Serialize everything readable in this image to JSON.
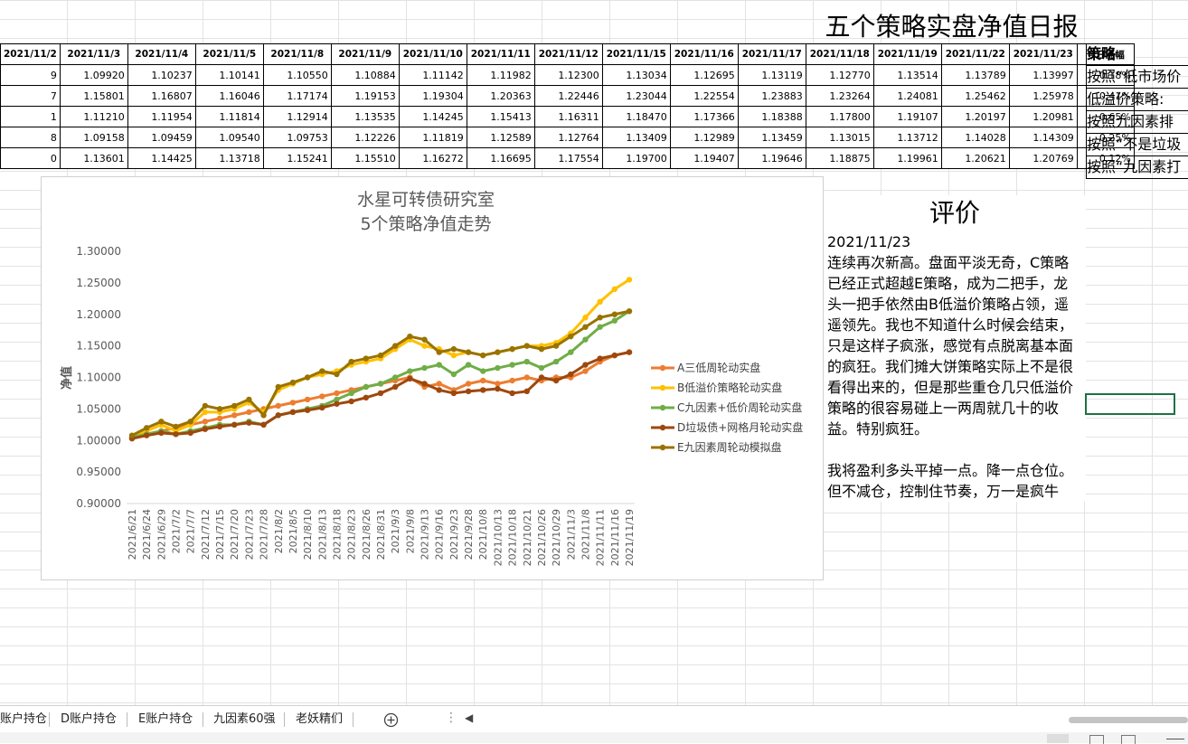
{
  "title": "五个策略实盘净值日报",
  "dates": [
    "2021/11/2",
    "2021/11/3",
    "2021/11/4",
    "2021/11/5",
    "2021/11/8",
    "2021/11/9",
    "2021/11/10",
    "2021/11/11",
    "2021/11/12",
    "2021/11/15",
    "2021/11/16",
    "2021/11/17",
    "2021/11/18",
    "2021/11/19",
    "2021/11/22",
    "2021/11/23"
  ],
  "change_header": "今日涨幅",
  "rows": [
    {
      "first": "9",
      "values": [
        "1.09920",
        "1.10237",
        "1.10141",
        "1.10550",
        "1.10884",
        "1.11142",
        "1.11982",
        "1.12300",
        "1.13034",
        "1.12695",
        "1.13119",
        "1.12770",
        "1.13514",
        "1.13789",
        "1.13997"
      ],
      "change": "0.18%"
    },
    {
      "first": "7",
      "values": [
        "1.15801",
        "1.16807",
        "1.16046",
        "1.17174",
        "1.19153",
        "1.19304",
        "1.20363",
        "1.22446",
        "1.23044",
        "1.22554",
        "1.23883",
        "1.23264",
        "1.24081",
        "1.25462",
        "1.25978"
      ],
      "change": "0.41%"
    },
    {
      "first": "1",
      "values": [
        "1.11210",
        "1.11954",
        "1.11814",
        "1.12914",
        "1.13535",
        "1.14245",
        "1.15413",
        "1.16311",
        "1.18470",
        "1.17366",
        "1.18388",
        "1.17800",
        "1.19107",
        "1.20197",
        "1.20981"
      ],
      "change": "0.65%"
    },
    {
      "first": "8",
      "values": [
        "1.09158",
        "1.09459",
        "1.09540",
        "1.09753",
        "1.12226",
        "1.11819",
        "1.12589",
        "1.12764",
        "1.13409",
        "1.12989",
        "1.13459",
        "1.13015",
        "1.13712",
        "1.14028",
        "1.14309"
      ],
      "change": "0.25%"
    },
    {
      "first": "0",
      "values": [
        "1.13601",
        "1.14425",
        "1.13718",
        "1.15241",
        "1.15510",
        "1.16272",
        "1.16695",
        "1.17554",
        "1.19700",
        "1.19407",
        "1.19646",
        "1.18875",
        "1.19961",
        "1.20621",
        "1.20769"
      ],
      "change": "0.12%"
    }
  ],
  "strategy_header": "策略",
  "strategies": [
    "按照“低市场价",
    "低溢价策略:",
    "按照九因素排",
    "按照“不是垃圾",
    "按照“九因素打"
  ],
  "evaluation": {
    "heading": "评价",
    "text": "2021/11/23\n连续再次新高。盘面平淡无奇，C策略已经正式超越E策略，成为二把手，龙头一把手依然由B低溢价策略占领，遥遥领先。我也不知道什么时候会结束，只是这样子疯涨，感觉有点脱离基本面的疯狂。我们摊大饼策略实际上不是很看得出来的，但是那些重仓几只低溢价策略的很容易碰上一两周就几十的收益。特别疯狂。\n\n我将盈利多头平掉一点。降一点仓位。但不减仓，控制住节奏，万一是疯牛"
  },
  "tabs": [
    "账户持仓",
    "D账户持仓",
    "E账户持仓",
    "九因素60强",
    "老妖精们"
  ],
  "add_sheet_icon": "plus-circle-icon",
  "chart_data": {
    "type": "line",
    "title": "水星可转债研究室",
    "subtitle": "5个策略净值走势",
    "ylabel": "净值",
    "ylim": [
      0.9,
      1.3
    ],
    "yticks": [
      "0.90000",
      "0.95000",
      "1.00000",
      "1.05000",
      "1.10000",
      "1.15000",
      "1.20000",
      "1.25000",
      "1.30000"
    ],
    "xticks": [
      "2021/6/21",
      "2021/6/24",
      "2021/6/29",
      "2021/7/2",
      "2021/7/7",
      "2021/7/12",
      "2021/7/15",
      "2021/7/20",
      "2021/7/23",
      "2021/7/28",
      "2021/8/2",
      "2021/8/5",
      "2021/8/10",
      "2021/8/13",
      "2021/8/18",
      "2021/8/23",
      "2021/8/26",
      "2021/8/31",
      "2021/9/3",
      "2021/9/8",
      "2021/9/13",
      "2021/9/16",
      "2021/9/23",
      "2021/9/28",
      "2021/10/8",
      "2021/10/13",
      "2021/10/18",
      "2021/10/21",
      "2021/10/26",
      "2021/10/29",
      "2021/11/3",
      "2021/11/8",
      "2021/11/11",
      "2021/11/16",
      "2021/11/19"
    ],
    "legend_position": "right",
    "grid": false,
    "series": [
      {
        "name": "A三低周轮动实盘",
        "color": "#ed7d31",
        "values": [
          1.005,
          1.01,
          1.015,
          1.02,
          1.025,
          1.03,
          1.035,
          1.04,
          1.045,
          1.05,
          1.055,
          1.06,
          1.065,
          1.07,
          1.075,
          1.08,
          1.085,
          1.09,
          1.095,
          1.1,
          1.085,
          1.09,
          1.08,
          1.09,
          1.095,
          1.09,
          1.095,
          1.1,
          1.095,
          1.1,
          1.1,
          1.11,
          1.125,
          1.135,
          1.14
        ]
      },
      {
        "name": "B低溢价策略轮动实盘",
        "color": "#ffc000",
        "values": [
          1.005,
          1.015,
          1.025,
          1.015,
          1.025,
          1.045,
          1.045,
          1.05,
          1.06,
          1.045,
          1.08,
          1.09,
          1.1,
          1.105,
          1.11,
          1.12,
          1.125,
          1.13,
          1.145,
          1.16,
          1.15,
          1.145,
          1.135,
          1.14,
          1.135,
          1.14,
          1.145,
          1.15,
          1.15,
          1.155,
          1.17,
          1.195,
          1.22,
          1.24,
          1.255
        ]
      },
      {
        "name": "C九因素+低价周轮动实盘",
        "color": "#70ad47",
        "values": [
          1.005,
          1.01,
          1.015,
          1.01,
          1.015,
          1.02,
          1.025,
          1.025,
          1.03,
          1.025,
          1.04,
          1.045,
          1.05,
          1.055,
          1.065,
          1.075,
          1.085,
          1.09,
          1.1,
          1.11,
          1.115,
          1.12,
          1.105,
          1.12,
          1.11,
          1.115,
          1.12,
          1.125,
          1.115,
          1.125,
          1.14,
          1.16,
          1.18,
          1.19,
          1.205
        ]
      },
      {
        "name": "D垃圾债+网格月轮动实盘",
        "color": "#9e480e",
        "values": [
          1.003,
          1.008,
          1.012,
          1.01,
          1.012,
          1.018,
          1.022,
          1.025,
          1.028,
          1.025,
          1.04,
          1.045,
          1.048,
          1.052,
          1.058,
          1.062,
          1.068,
          1.075,
          1.085,
          1.098,
          1.09,
          1.08,
          1.075,
          1.078,
          1.08,
          1.082,
          1.075,
          1.078,
          1.1,
          1.095,
          1.105,
          1.12,
          1.13,
          1.135,
          1.14
        ]
      },
      {
        "name": "E九因素周轮动模拟盘",
        "color": "#997300",
        "values": [
          1.008,
          1.02,
          1.03,
          1.022,
          1.03,
          1.055,
          1.05,
          1.055,
          1.065,
          1.04,
          1.085,
          1.092,
          1.1,
          1.11,
          1.105,
          1.125,
          1.13,
          1.135,
          1.15,
          1.165,
          1.16,
          1.14,
          1.145,
          1.14,
          1.135,
          1.14,
          1.145,
          1.15,
          1.145,
          1.15,
          1.165,
          1.18,
          1.195,
          1.2,
          1.205
        ]
      }
    ]
  }
}
